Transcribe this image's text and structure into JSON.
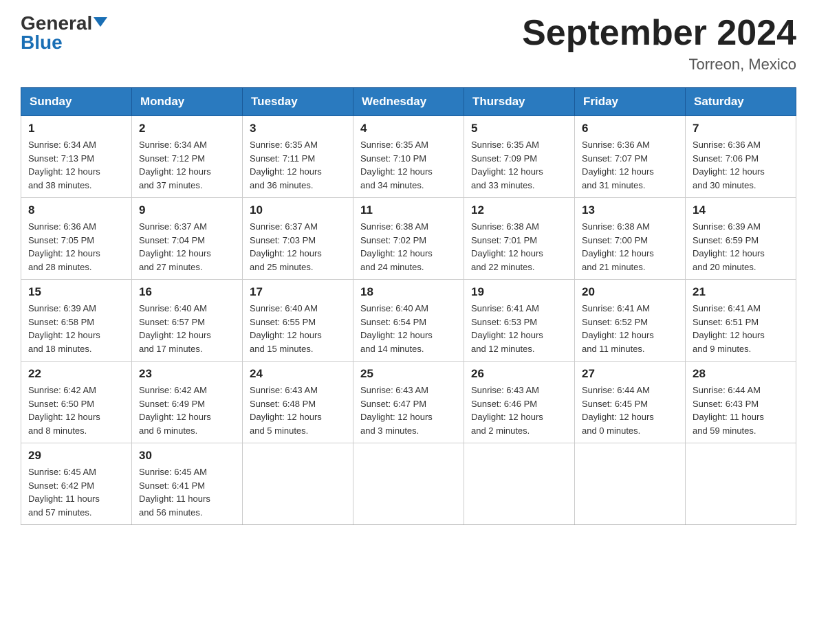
{
  "header": {
    "logo_general": "General",
    "logo_blue": "Blue",
    "month_title": "September 2024",
    "location": "Torreon, Mexico"
  },
  "days_of_week": [
    "Sunday",
    "Monday",
    "Tuesday",
    "Wednesday",
    "Thursday",
    "Friday",
    "Saturday"
  ],
  "weeks": [
    [
      {
        "day": "1",
        "sunrise": "6:34 AM",
        "sunset": "7:13 PM",
        "daylight": "12 hours and 38 minutes."
      },
      {
        "day": "2",
        "sunrise": "6:34 AM",
        "sunset": "7:12 PM",
        "daylight": "12 hours and 37 minutes."
      },
      {
        "day": "3",
        "sunrise": "6:35 AM",
        "sunset": "7:11 PM",
        "daylight": "12 hours and 36 minutes."
      },
      {
        "day": "4",
        "sunrise": "6:35 AM",
        "sunset": "7:10 PM",
        "daylight": "12 hours and 34 minutes."
      },
      {
        "day": "5",
        "sunrise": "6:35 AM",
        "sunset": "7:09 PM",
        "daylight": "12 hours and 33 minutes."
      },
      {
        "day": "6",
        "sunrise": "6:36 AM",
        "sunset": "7:07 PM",
        "daylight": "12 hours and 31 minutes."
      },
      {
        "day": "7",
        "sunrise": "6:36 AM",
        "sunset": "7:06 PM",
        "daylight": "12 hours and 30 minutes."
      }
    ],
    [
      {
        "day": "8",
        "sunrise": "6:36 AM",
        "sunset": "7:05 PM",
        "daylight": "12 hours and 28 minutes."
      },
      {
        "day": "9",
        "sunrise": "6:37 AM",
        "sunset": "7:04 PM",
        "daylight": "12 hours and 27 minutes."
      },
      {
        "day": "10",
        "sunrise": "6:37 AM",
        "sunset": "7:03 PM",
        "daylight": "12 hours and 25 minutes."
      },
      {
        "day": "11",
        "sunrise": "6:38 AM",
        "sunset": "7:02 PM",
        "daylight": "12 hours and 24 minutes."
      },
      {
        "day": "12",
        "sunrise": "6:38 AM",
        "sunset": "7:01 PM",
        "daylight": "12 hours and 22 minutes."
      },
      {
        "day": "13",
        "sunrise": "6:38 AM",
        "sunset": "7:00 PM",
        "daylight": "12 hours and 21 minutes."
      },
      {
        "day": "14",
        "sunrise": "6:39 AM",
        "sunset": "6:59 PM",
        "daylight": "12 hours and 20 minutes."
      }
    ],
    [
      {
        "day": "15",
        "sunrise": "6:39 AM",
        "sunset": "6:58 PM",
        "daylight": "12 hours and 18 minutes."
      },
      {
        "day": "16",
        "sunrise": "6:40 AM",
        "sunset": "6:57 PM",
        "daylight": "12 hours and 17 minutes."
      },
      {
        "day": "17",
        "sunrise": "6:40 AM",
        "sunset": "6:55 PM",
        "daylight": "12 hours and 15 minutes."
      },
      {
        "day": "18",
        "sunrise": "6:40 AM",
        "sunset": "6:54 PM",
        "daylight": "12 hours and 14 minutes."
      },
      {
        "day": "19",
        "sunrise": "6:41 AM",
        "sunset": "6:53 PM",
        "daylight": "12 hours and 12 minutes."
      },
      {
        "day": "20",
        "sunrise": "6:41 AM",
        "sunset": "6:52 PM",
        "daylight": "12 hours and 11 minutes."
      },
      {
        "day": "21",
        "sunrise": "6:41 AM",
        "sunset": "6:51 PM",
        "daylight": "12 hours and 9 minutes."
      }
    ],
    [
      {
        "day": "22",
        "sunrise": "6:42 AM",
        "sunset": "6:50 PM",
        "daylight": "12 hours and 8 minutes."
      },
      {
        "day": "23",
        "sunrise": "6:42 AM",
        "sunset": "6:49 PM",
        "daylight": "12 hours and 6 minutes."
      },
      {
        "day": "24",
        "sunrise": "6:43 AM",
        "sunset": "6:48 PM",
        "daylight": "12 hours and 5 minutes."
      },
      {
        "day": "25",
        "sunrise": "6:43 AM",
        "sunset": "6:47 PM",
        "daylight": "12 hours and 3 minutes."
      },
      {
        "day": "26",
        "sunrise": "6:43 AM",
        "sunset": "6:46 PM",
        "daylight": "12 hours and 2 minutes."
      },
      {
        "day": "27",
        "sunrise": "6:44 AM",
        "sunset": "6:45 PM",
        "daylight": "12 hours and 0 minutes."
      },
      {
        "day": "28",
        "sunrise": "6:44 AM",
        "sunset": "6:43 PM",
        "daylight": "11 hours and 59 minutes."
      }
    ],
    [
      {
        "day": "29",
        "sunrise": "6:45 AM",
        "sunset": "6:42 PM",
        "daylight": "11 hours and 57 minutes."
      },
      {
        "day": "30",
        "sunrise": "6:45 AM",
        "sunset": "6:41 PM",
        "daylight": "11 hours and 56 minutes."
      },
      null,
      null,
      null,
      null,
      null
    ]
  ],
  "labels": {
    "sunrise_prefix": "Sunrise: ",
    "sunset_prefix": "Sunset: ",
    "daylight_prefix": "Daylight: "
  }
}
